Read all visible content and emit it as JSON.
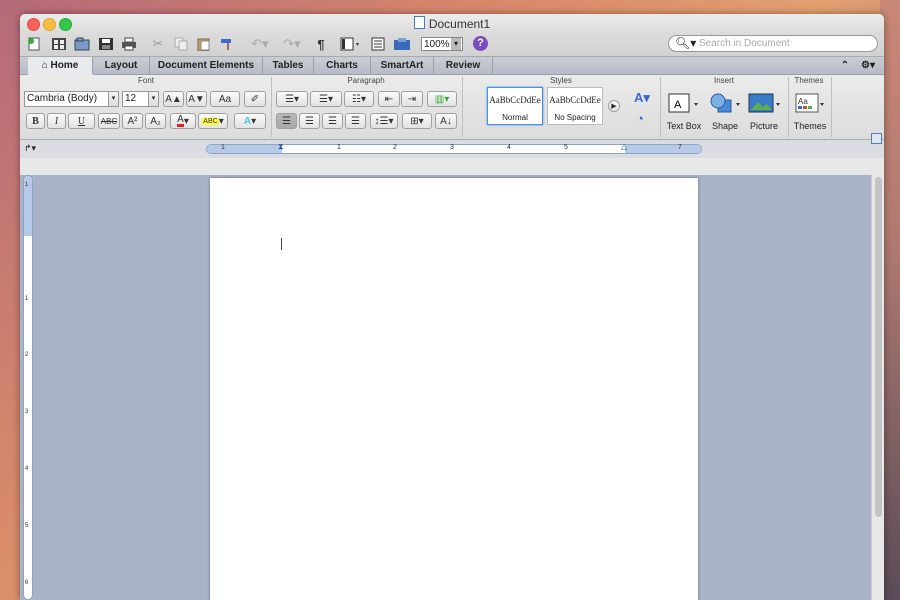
{
  "window": {
    "title": "Document1"
  },
  "toolbar": {
    "zoom": "100%",
    "search_placeholder": "Search in Document",
    "icons": [
      "new-document-icon",
      "templates-icon",
      "open-icon",
      "save-icon",
      "print-icon",
      "cut-icon",
      "copy-icon",
      "paste-icon",
      "format-painter-icon",
      "undo-icon",
      "redo-icon",
      "pilcrow-icon",
      "view-icon",
      "sidebar-icon",
      "media-browser-icon",
      "help-icon"
    ],
    "pilcrow": "¶",
    "help": "?"
  },
  "tabs": [
    {
      "label": "Home",
      "active": true
    },
    {
      "label": "Layout"
    },
    {
      "label": "Document Elements"
    },
    {
      "label": "Tables"
    },
    {
      "label": "Charts"
    },
    {
      "label": "SmartArt"
    },
    {
      "label": "Review"
    }
  ],
  "ribbon": {
    "groups": {
      "font": "Font",
      "paragraph": "Paragraph",
      "styles": "Styles",
      "insert": "Insert",
      "themes": "Themes"
    },
    "font_name": "Cambria (Body)",
    "font_size": "12",
    "format_buttons": {
      "bold": "B",
      "italic": "I",
      "underline": "U",
      "strike": "ABC",
      "superscript": "A²",
      "subscript": "A₂",
      "grow": "A▲",
      "shrink": "A▼",
      "case": "Aa"
    },
    "styles": [
      {
        "sample": "AaBbCcDdEe",
        "name": "Normal",
        "selected": true
      },
      {
        "sample": "AaBbCcDdEe",
        "name": "No Spacing"
      }
    ],
    "insert_items": [
      {
        "label": "Text Box"
      },
      {
        "label": "Shape"
      },
      {
        "label": "Picture"
      }
    ],
    "themes_item": "Themes"
  },
  "ruler": {
    "numbers": [
      "1",
      "1",
      "2",
      "3",
      "4",
      "5",
      "7"
    ]
  },
  "vruler": {
    "numbers": [
      "1",
      "1",
      "2",
      "3",
      "4",
      "5",
      "6"
    ]
  },
  "colors": {
    "accent": "#4a90e0",
    "help_purple": "#7b4cc0",
    "canvas": "#a9b3c7"
  }
}
